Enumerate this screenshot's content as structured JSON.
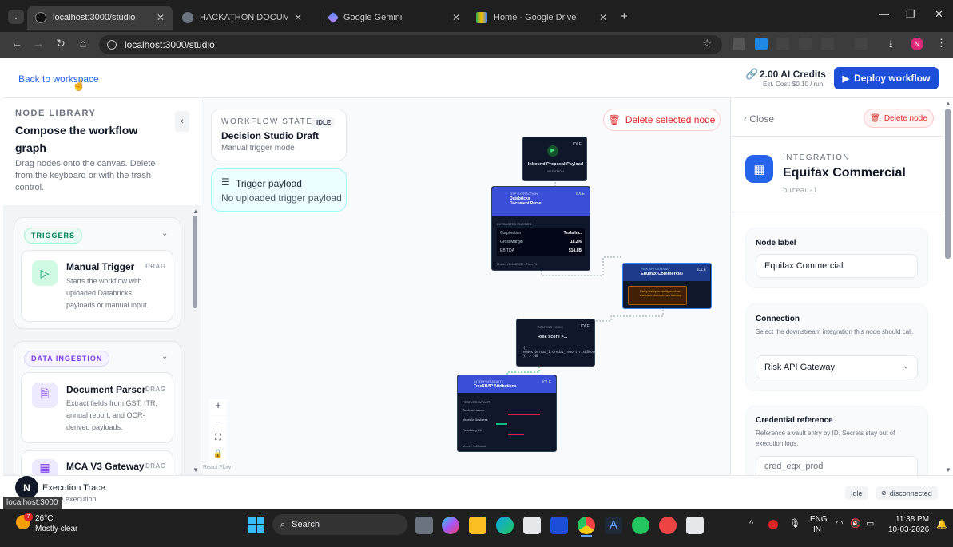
{
  "browser": {
    "tabs": [
      {
        "title": "localhost:3000/studio",
        "active": true
      },
      {
        "title": "HACKATHON DOCUMENTATION",
        "active": false
      },
      {
        "title": "Google Gemini",
        "active": false
      },
      {
        "title": "Home - Google Drive",
        "active": false
      }
    ],
    "new_tab": "+",
    "url": "localhost:3000/studio",
    "profile_initial": "N"
  },
  "header": {
    "back_link": "Back to workspace",
    "credits": "2.00 AI Credits",
    "est_cost": "Est. Cost: $0.10 / run",
    "deploy_label": "Deploy workflow"
  },
  "sidebar": {
    "label": "NODE LIBRARY",
    "title": "Compose the workflow graph",
    "description": "Drag nodes onto the canvas. Delete from the keyboard or with the trash control.",
    "sections": [
      {
        "name": "TRIGGERS",
        "items": [
          {
            "title": "Manual Trigger",
            "tag": "DRAG",
            "description": "Starts the workflow with uploaded Databricks payloads or manual input."
          }
        ]
      },
      {
        "name": "DATA INGESTION",
        "items": [
          {
            "title": "Document Parser",
            "tag": "DRAG",
            "description": "Extract fields from GST, ITR, annual report, and OCR-derived payloads."
          },
          {
            "title": "MCA V3 Gateway",
            "tag": "DRAG",
            "description": ""
          }
        ]
      }
    ]
  },
  "canvas": {
    "state_label": "WORKFLOW STATE",
    "state_badge": "IDLE",
    "workflow_name": "Decision Studio Draft",
    "mode": "Manual trigger mode",
    "trigger_title": "Trigger payload",
    "trigger_sub": "No uploaded trigger payload",
    "delete_selected": "Delete selected node",
    "attribution": "React Flow",
    "nodes": {
      "inbound": {
        "title": "Inbound Proposal Payload",
        "sub": "INITIATION",
        "badge": "IDLE"
      },
      "parser": {
        "kind": "GSP EXTRACTION",
        "title": "Databricks Document Parse",
        "badge": "IDLE",
        "section": "EXTRACTED ENTITIES",
        "rows": [
          [
            "Corporation",
            "Tesla Inc."
          ],
          [
            "GrossMargin",
            "18.2%"
          ],
          [
            "EBITDA",
            "$14.8B"
          ]
        ],
        "footer": "Model: GLM4OCR • Flan-T5"
      },
      "equifax": {
        "kind": "RISK API GATEWAY",
        "title": "Equifax Commercial",
        "badge": "IDLE",
        "note": "Retry policy is configured for transient downstream latency."
      },
      "routing": {
        "kind": "ROUTING LOGIC",
        "title": "Risk score >...",
        "badge": "IDLE",
        "code": "{{ nodes.bureau_1.credit_report.riskScore }} > 700"
      },
      "shap": {
        "kind": "INTERPRETABILITY",
        "title": "TreeSHAP Attributions",
        "badge": "IDLE",
        "section": "FEATURE IMPACT",
        "rows": [
          "Debt-to-Income",
          "Years in Business",
          "Revolving Util"
        ],
        "footer": "Model: XGBoost"
      }
    }
  },
  "right_panel": {
    "close_label": "Close",
    "delete_label": "Delete node",
    "kind": "INTEGRATION",
    "name": "Equifax Commercial",
    "node_id": "bureau-1",
    "node_label_title": "Node label",
    "node_label_value": "Equifax Commercial",
    "connection_title": "Connection",
    "connection_help": "Select the downstream integration this node should call.",
    "connection_value": "Risk API Gateway",
    "credential_title": "Credential reference",
    "credential_help": "Reference a vault entry by ID. Secrets stay out of execution logs.",
    "credential_value": "cred_eqx_prod"
  },
  "trace": {
    "avatar": "N",
    "title": "Execution Trace",
    "subtitle": "ctive execution",
    "status_tip": "localhost:3000",
    "state": "Idle",
    "connection": "disconnected"
  },
  "taskbar": {
    "temp": "26°C",
    "weather": "Mostly clear",
    "weather_badge": "7",
    "search": "Search",
    "lang1": "ENG",
    "lang2": "IN",
    "time": "11:38 PM",
    "date": "10-03-2026"
  },
  "colors": {
    "accent": "#1d4ed8",
    "danger": "#dc2626",
    "trigger_green": "#10b981",
    "ingestion_purple": "#7c3aed"
  }
}
